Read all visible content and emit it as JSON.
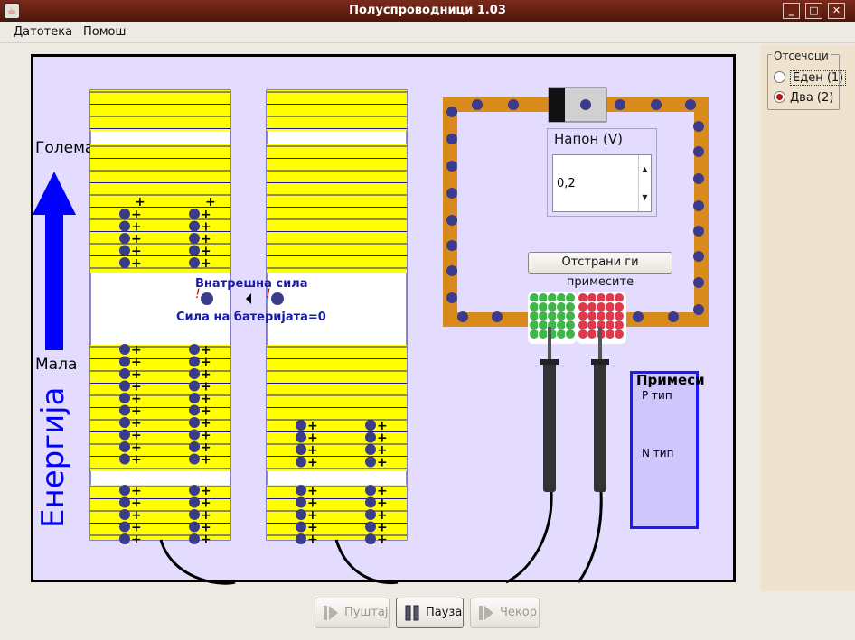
{
  "window": {
    "title": "Полуспроводници 1.03",
    "minimize": "_",
    "maximize": "□",
    "close": "✕"
  },
  "menu": {
    "file": "Датотека",
    "help": "Помош"
  },
  "energy_axis": {
    "high": "Голема",
    "low": "Мала",
    "label": "Енергија"
  },
  "band_labels": {
    "internal_force": "Внатрешна сила",
    "battery_force": "Сила на батеријата=0",
    "warning": "!"
  },
  "voltage": {
    "legend": "Напон (V)",
    "value": "0,2",
    "up": "▲",
    "down": "▼"
  },
  "remove_button": "Отстрани ги примесите",
  "dopants": {
    "title": "Примеси",
    "p_type": "P тип",
    "n_type": "N тип"
  },
  "sections": {
    "legend": "Отсечоци",
    "one": "Еден (1)",
    "two": "Два (2)",
    "selected": "two"
  },
  "playback": {
    "play": "Пуштај",
    "pause": "Пауза",
    "step": "Чекор"
  },
  "colors": {
    "band": "#ffff00",
    "wire": "#d98a1c",
    "electron": "#3b3b8c",
    "p_dopant": "#e0394b",
    "n_dopant": "#3fb54a",
    "arrow": "#0000ff"
  }
}
